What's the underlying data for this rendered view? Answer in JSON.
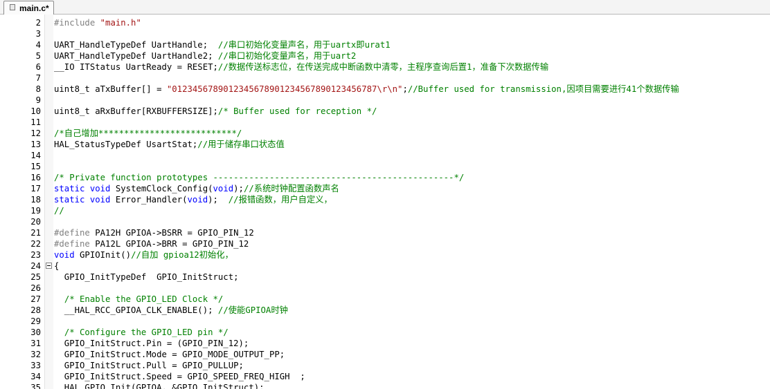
{
  "tab": {
    "label": "main.c*",
    "icon": "file-icon"
  },
  "lines": [
    {
      "n": "2",
      "segs": [
        {
          "t": "#include ",
          "c": "pp"
        },
        {
          "t": "\"main.h\"",
          "c": "str"
        }
      ]
    },
    {
      "n": "3",
      "segs": []
    },
    {
      "n": "4",
      "segs": [
        {
          "t": "UART_HandleTypeDef UartHandle;  ",
          "c": ""
        },
        {
          "t": "//串口初始化变量声名，用于uartx即urat1",
          "c": "cm"
        }
      ]
    },
    {
      "n": "5",
      "segs": [
        {
          "t": "UART_HandleTypeDef UartHandle2; ",
          "c": ""
        },
        {
          "t": "//串口初始化变量声名，用于uart2",
          "c": "cm"
        }
      ]
    },
    {
      "n": "6",
      "segs": [
        {
          "t": "__IO ITStatus UartReady = RESET;",
          "c": ""
        },
        {
          "t": "//数据传送标志位，在传送完成中断函数中清零，主程序查询后置1，准备下次数据传输",
          "c": "cm"
        }
      ]
    },
    {
      "n": "7",
      "segs": []
    },
    {
      "n": "8",
      "segs": [
        {
          "t": "uint8_t aTxBuffer[] = ",
          "c": ""
        },
        {
          "t": "\"0123456789012345678901234567890123456787\\r\\n\"",
          "c": "str"
        },
        {
          "t": ";",
          "c": ""
        },
        {
          "t": "//Buffer used for transmission,因项目需要进行41个数据传输",
          "c": "cm"
        }
      ]
    },
    {
      "n": "9",
      "segs": []
    },
    {
      "n": "10",
      "segs": [
        {
          "t": "uint8_t aRxBuffer[RXBUFFERSIZE];",
          "c": ""
        },
        {
          "t": "/* Buffer used for reception */",
          "c": "cm"
        }
      ]
    },
    {
      "n": "11",
      "segs": []
    },
    {
      "n": "12",
      "segs": [
        {
          "t": "/*自己增加***************************/",
          "c": "cm"
        }
      ]
    },
    {
      "n": "13",
      "segs": [
        {
          "t": "HAL_StatusTypeDef UsartStat;",
          "c": ""
        },
        {
          "t": "//用于储存串口状态值",
          "c": "cm"
        }
      ]
    },
    {
      "n": "14",
      "segs": []
    },
    {
      "n": "15",
      "segs": []
    },
    {
      "n": "16",
      "segs": [
        {
          "t": "/* Private function prototypes -----------------------------------------------*/",
          "c": "cm"
        }
      ]
    },
    {
      "n": "17",
      "segs": [
        {
          "t": "static ",
          "c": "kw"
        },
        {
          "t": "void ",
          "c": "kw"
        },
        {
          "t": "SystemClock_Config(",
          "c": ""
        },
        {
          "t": "void",
          "c": "kw"
        },
        {
          "t": ");",
          "c": ""
        },
        {
          "t": "//系统时钟配置函数声名",
          "c": "cm"
        }
      ]
    },
    {
      "n": "18",
      "segs": [
        {
          "t": "static ",
          "c": "kw"
        },
        {
          "t": "void ",
          "c": "kw"
        },
        {
          "t": "Error_Handler(",
          "c": ""
        },
        {
          "t": "void",
          "c": "kw"
        },
        {
          "t": ");  ",
          "c": ""
        },
        {
          "t": "//报错函数，用户自定义，",
          "c": "cm"
        }
      ]
    },
    {
      "n": "19",
      "segs": [
        {
          "t": "//",
          "c": "cm"
        }
      ]
    },
    {
      "n": "20",
      "segs": []
    },
    {
      "n": "21",
      "segs": [
        {
          "t": "#define ",
          "c": "pp"
        },
        {
          "t": "PA12H GPIOA->BSRR = GPIO_PIN_12",
          "c": ""
        }
      ]
    },
    {
      "n": "22",
      "segs": [
        {
          "t": "#define ",
          "c": "pp"
        },
        {
          "t": "PA12L GPIOA->BRR = GPIO_PIN_12",
          "c": ""
        }
      ]
    },
    {
      "n": "23",
      "segs": [
        {
          "t": "void ",
          "c": "kw"
        },
        {
          "t": "GPIOInit()",
          "c": ""
        },
        {
          "t": "//自加 gpioa12初始化，",
          "c": "cm"
        }
      ]
    },
    {
      "n": "24",
      "fold": true,
      "segs": [
        {
          "t": "{",
          "c": ""
        }
      ]
    },
    {
      "n": "25",
      "segs": [
        {
          "t": "  GPIO_InitTypeDef  GPIO_InitStruct;",
          "c": ""
        }
      ]
    },
    {
      "n": "26",
      "segs": []
    },
    {
      "n": "27",
      "segs": [
        {
          "t": "  ",
          "c": ""
        },
        {
          "t": "/* Enable the GPIO_LED Clock */",
          "c": "cm"
        }
      ]
    },
    {
      "n": "28",
      "segs": [
        {
          "t": "  __HAL_RCC_GPIOA_CLK_ENABLE(); ",
          "c": ""
        },
        {
          "t": "//使能GPIOA时钟",
          "c": "cm"
        }
      ]
    },
    {
      "n": "29",
      "segs": []
    },
    {
      "n": "30",
      "segs": [
        {
          "t": "  ",
          "c": ""
        },
        {
          "t": "/* Configure the GPIO_LED pin */",
          "c": "cm"
        }
      ]
    },
    {
      "n": "31",
      "segs": [
        {
          "t": "  GPIO_InitStruct.Pin = (GPIO_PIN_12);",
          "c": ""
        }
      ]
    },
    {
      "n": "32",
      "segs": [
        {
          "t": "  GPIO_InitStruct.Mode = GPIO_MODE_OUTPUT_PP;",
          "c": ""
        }
      ]
    },
    {
      "n": "33",
      "segs": [
        {
          "t": "  GPIO_InitStruct.Pull = GPIO_PULLUP;",
          "c": ""
        }
      ]
    },
    {
      "n": "34",
      "segs": [
        {
          "t": "  GPIO_InitStruct.Speed = GPIO_SPEED_FREQ_HIGH  ;",
          "c": ""
        }
      ]
    },
    {
      "n": "35",
      "segs": [
        {
          "t": "  HAL_GPIO_Init(GPIOA, &GPIO_InitStruct);",
          "c": ""
        }
      ]
    }
  ]
}
